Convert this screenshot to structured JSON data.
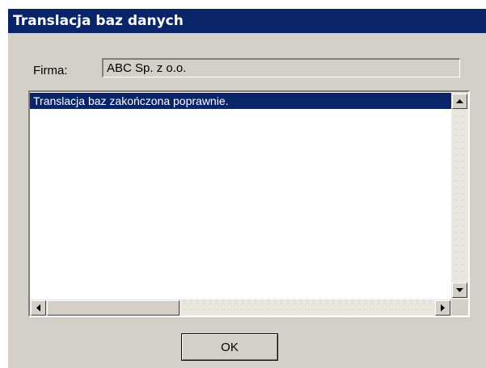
{
  "window": {
    "title": "Translacja baz danych"
  },
  "form": {
    "firma_label": "Firma:",
    "firma_value": "ABC Sp. z o.o."
  },
  "log": {
    "items": [
      "Translacja baz zakończona poprawnie."
    ]
  },
  "buttons": {
    "ok_label": "OK"
  },
  "icons": {
    "scroll_up": "arrow-up-icon",
    "scroll_down": "arrow-down-icon",
    "scroll_left": "arrow-left-icon",
    "scroll_right": "arrow-right-icon"
  },
  "colors": {
    "titlebar": "#0a246a",
    "selection": "#0a246a",
    "face": "#d4d0c8"
  }
}
